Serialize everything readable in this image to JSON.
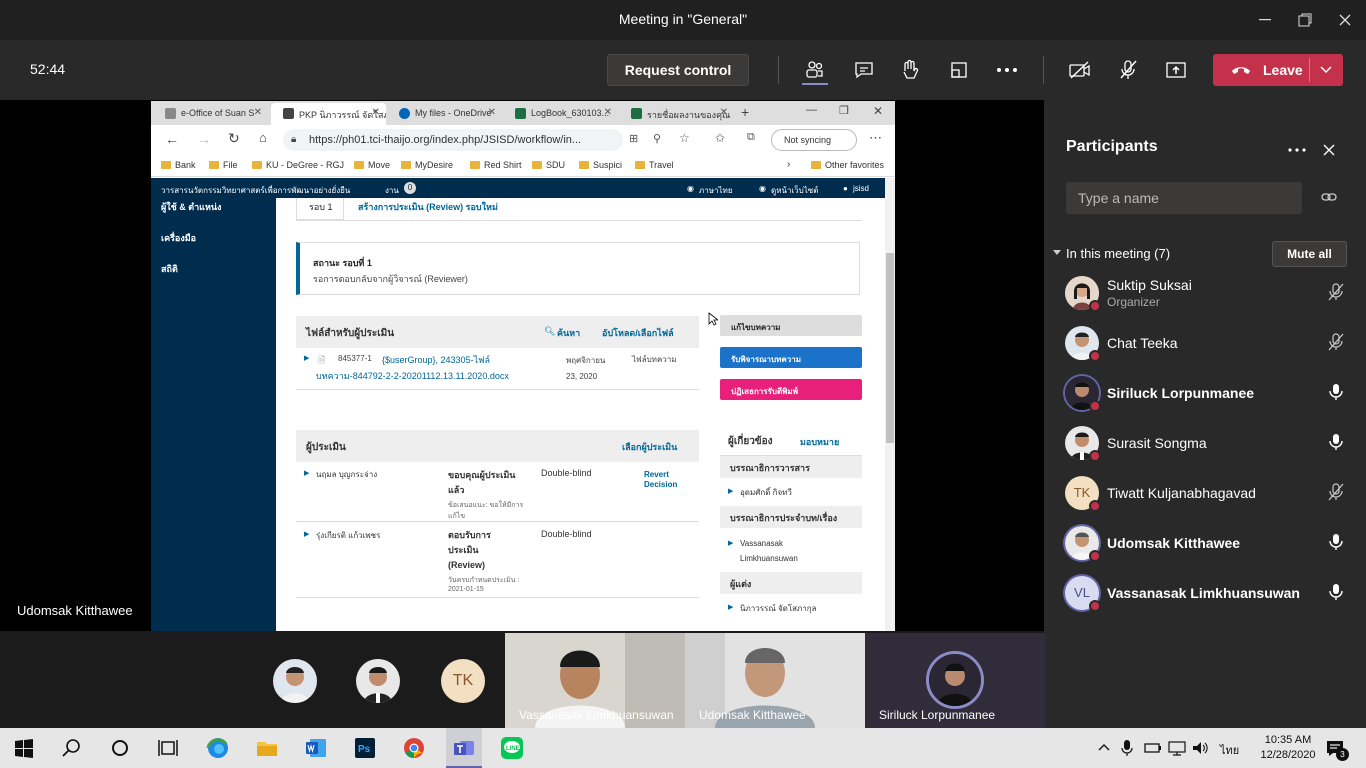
{
  "window": {
    "title": "Meeting in \"General\""
  },
  "toolbar": {
    "timer": "52:44",
    "request_control": "Request control",
    "leave": "Leave"
  },
  "stage": {
    "presenter_name": "Udomsak Kitthawee"
  },
  "browser": {
    "tabs": [
      {
        "label": "e-Office of Suan S",
        "fav_color": "#888888"
      },
      {
        "label": "PKP นิภาวรรณ์ จัดโสภากุล",
        "fav_color": "#444444"
      },
      {
        "label": "My files - OneDrive",
        "fav_color": "#0364b8"
      },
      {
        "label": "LogBook_630103...",
        "fav_color": "#1d6f42"
      },
      {
        "label": "รายชื่อผลงานของคุณ",
        "fav_color": "#1d6f42"
      }
    ],
    "url": "https://ph01.tci-thaijo.org/index.php/JSISD/workflow/in...",
    "not_syncing": "Not syncing",
    "bookmarks": [
      "Bank",
      "File",
      "KU - DeGree - RGJ",
      "Move",
      "MyDesire",
      "Red Shirt",
      "SDU",
      "Suspici",
      "Travel"
    ],
    "other_favorites": "Other favorites"
  },
  "site": {
    "header_title": "วารสารนวัตกรรมวิทยาศาสตร์เพื่อการพัฒนาอย่างยั่งยืน",
    "tasks_label": "งาน",
    "tasks_count": "0",
    "language": "ภาษาไทย",
    "view_site": "ดูหน้าเว็บไซต์",
    "user": "jsisd",
    "side_nav": [
      "ผู้ใช้ & ตำแหน่ง",
      "เครื่องมือ",
      "สถิติ"
    ],
    "round_tab": "รอบ 1",
    "new_round_tab": "สร้างการประเมิน (Review) รอบใหม่",
    "status_title": "สถานะ รอบที่ 1",
    "status_detail": "รอการตอบกลับจากผู้วิจารณ์ (Reviewer)",
    "files_header": "ไฟล์สำหรับผู้ประเมิน",
    "search_link": "ค้นหา",
    "upload_link": "อัปโหลด/เลือกไฟล์",
    "file_id": "845377-1",
    "file_name_1": "{$userGroup}, 243305-ไฟล์",
    "file_name_2": "บทความ-844792-2-2-20201112.13.11.2020.docx",
    "file_date": "พฤศจิกายน 23, 2020",
    "file_type": "ไฟล์บทความ",
    "btn_edit": "แก้ไขบทความ",
    "btn_accept": "รับพิจารณาบทความ",
    "btn_decline": "ปฏิเสธการรับตีพิมพ์",
    "reviewers_header": "ผู้ประเมิน",
    "select_reviewer": "เลือกผู้ประเมิน",
    "reviewers": [
      {
        "name": "นฤมล บุญกระจ่าง",
        "status": "ขอบคุณผู้ประเมินแล้ว",
        "note": "ข้อเสนอแนะ: ขอให้มีการแก้ไข",
        "type": "Double-blind",
        "action": "Revert Decision"
      },
      {
        "name": "รุ่งเกียรติ แก้วเพชร",
        "status": "ตอบรับการประเมิน (Review)",
        "note": "วันครบกำหนดประเมิน : 2021-01-15",
        "type": "Double-blind",
        "action": ""
      }
    ],
    "participants_header": "ผู้เกี่ยวข้อง",
    "assign_link": "มอบหมาย",
    "groups": [
      {
        "title": "บรรณาธิการวารสาร",
        "members": [
          "อุดมศักดิ์ กิจทวี"
        ]
      },
      {
        "title": "บรรณาธิการประจำบท/เรื่อง",
        "members": [
          "Vassanasak Limkhuansuwan"
        ]
      },
      {
        "title": "ผู้แต่ง",
        "members": [
          "นิภาวรรณ์ จัดโสภากุล"
        ]
      }
    ]
  },
  "participants": {
    "title": "Participants",
    "search_placeholder": "Type a name",
    "in_meeting": "In this meeting (7)",
    "mute_all": "Mute all",
    "list": [
      {
        "name": "Suktip Suksai",
        "role": "Organizer",
        "initials": "",
        "mic": "muted"
      },
      {
        "name": "Chat Teeka",
        "role": "",
        "initials": "",
        "mic": "muted"
      },
      {
        "name": "Siriluck Lorpunmanee",
        "role": "",
        "initials": "",
        "mic": "on"
      },
      {
        "name": "Surasit Songma",
        "role": "",
        "initials": "",
        "mic": "on"
      },
      {
        "name": "Tiwatt Kuljanabhagavad",
        "role": "",
        "initials": "TK",
        "mic": "muted"
      },
      {
        "name": "Udomsak Kitthawee",
        "role": "",
        "initials": "",
        "mic": "on"
      },
      {
        "name": "Vassanasak Limkhuansuwan",
        "role": "",
        "initials": "VL",
        "mic": "on"
      }
    ]
  },
  "strip": {
    "tiles": [
      "Vassanasak Limkhuansuwan",
      "Udomsak Kitthawee",
      "Siriluck Lorpunmanee"
    ],
    "mini_initials": "TK"
  },
  "taskbar": {
    "time": "10:35 AM",
    "date": "12/28/2020",
    "lang": "ไทย"
  },
  "colors": {
    "leave": "#c4314b",
    "accent": "#6264a7",
    "site_blue": "#002c4e",
    "accept_btn": "#1a73c8",
    "decline_btn": "#e8207b"
  }
}
